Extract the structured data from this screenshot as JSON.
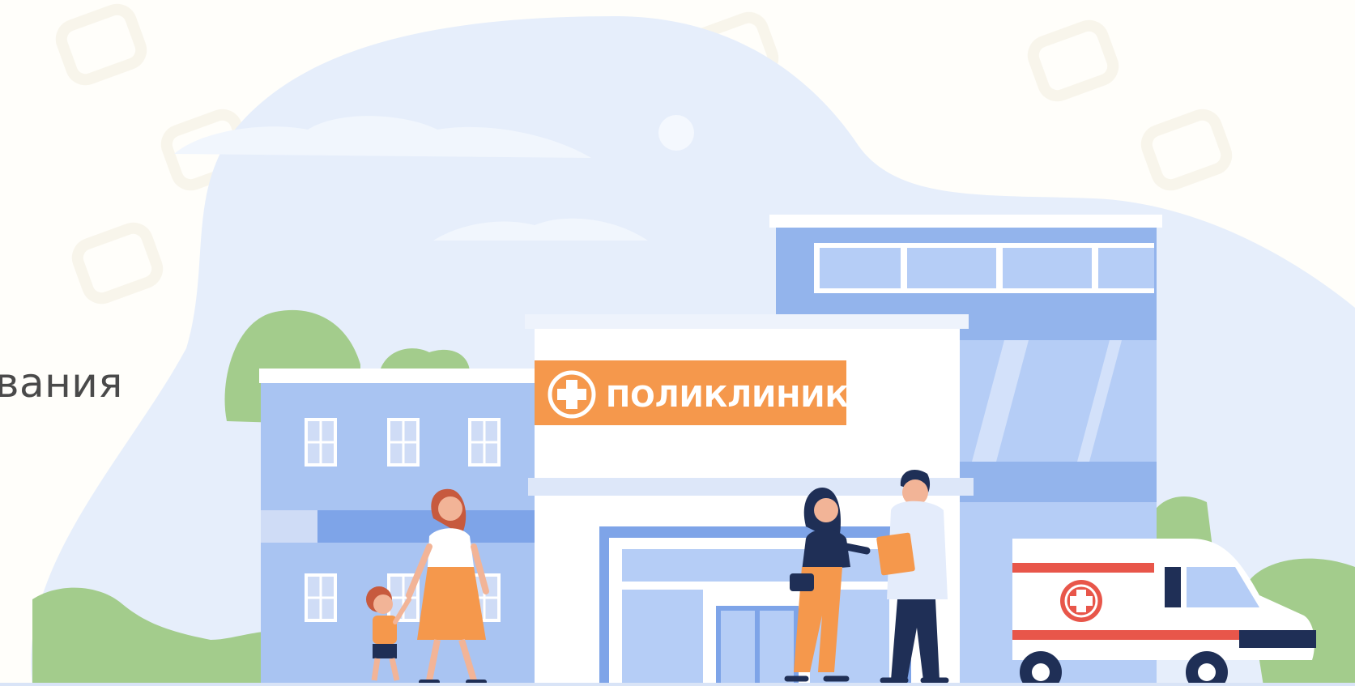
{
  "banner": {
    "partial_heading": "вания",
    "clinic_sign": "ПОЛИКЛИНИКА"
  },
  "colors": {
    "background": "#fffefa",
    "blob": "#e6eefb",
    "building_blue": "#a9c4f2",
    "building_dark_blue": "#93b4ec",
    "window_blue": "#b5cdf6",
    "sign_orange": "#f5984c",
    "tree_green": "#a3cc8c",
    "ambulance_red": "#e8564a",
    "doctor_coat": "#e4ecfb",
    "navy": "#1f2f56"
  },
  "icons": [
    "medical-cross-icon",
    "ambulance-cross-icon"
  ]
}
